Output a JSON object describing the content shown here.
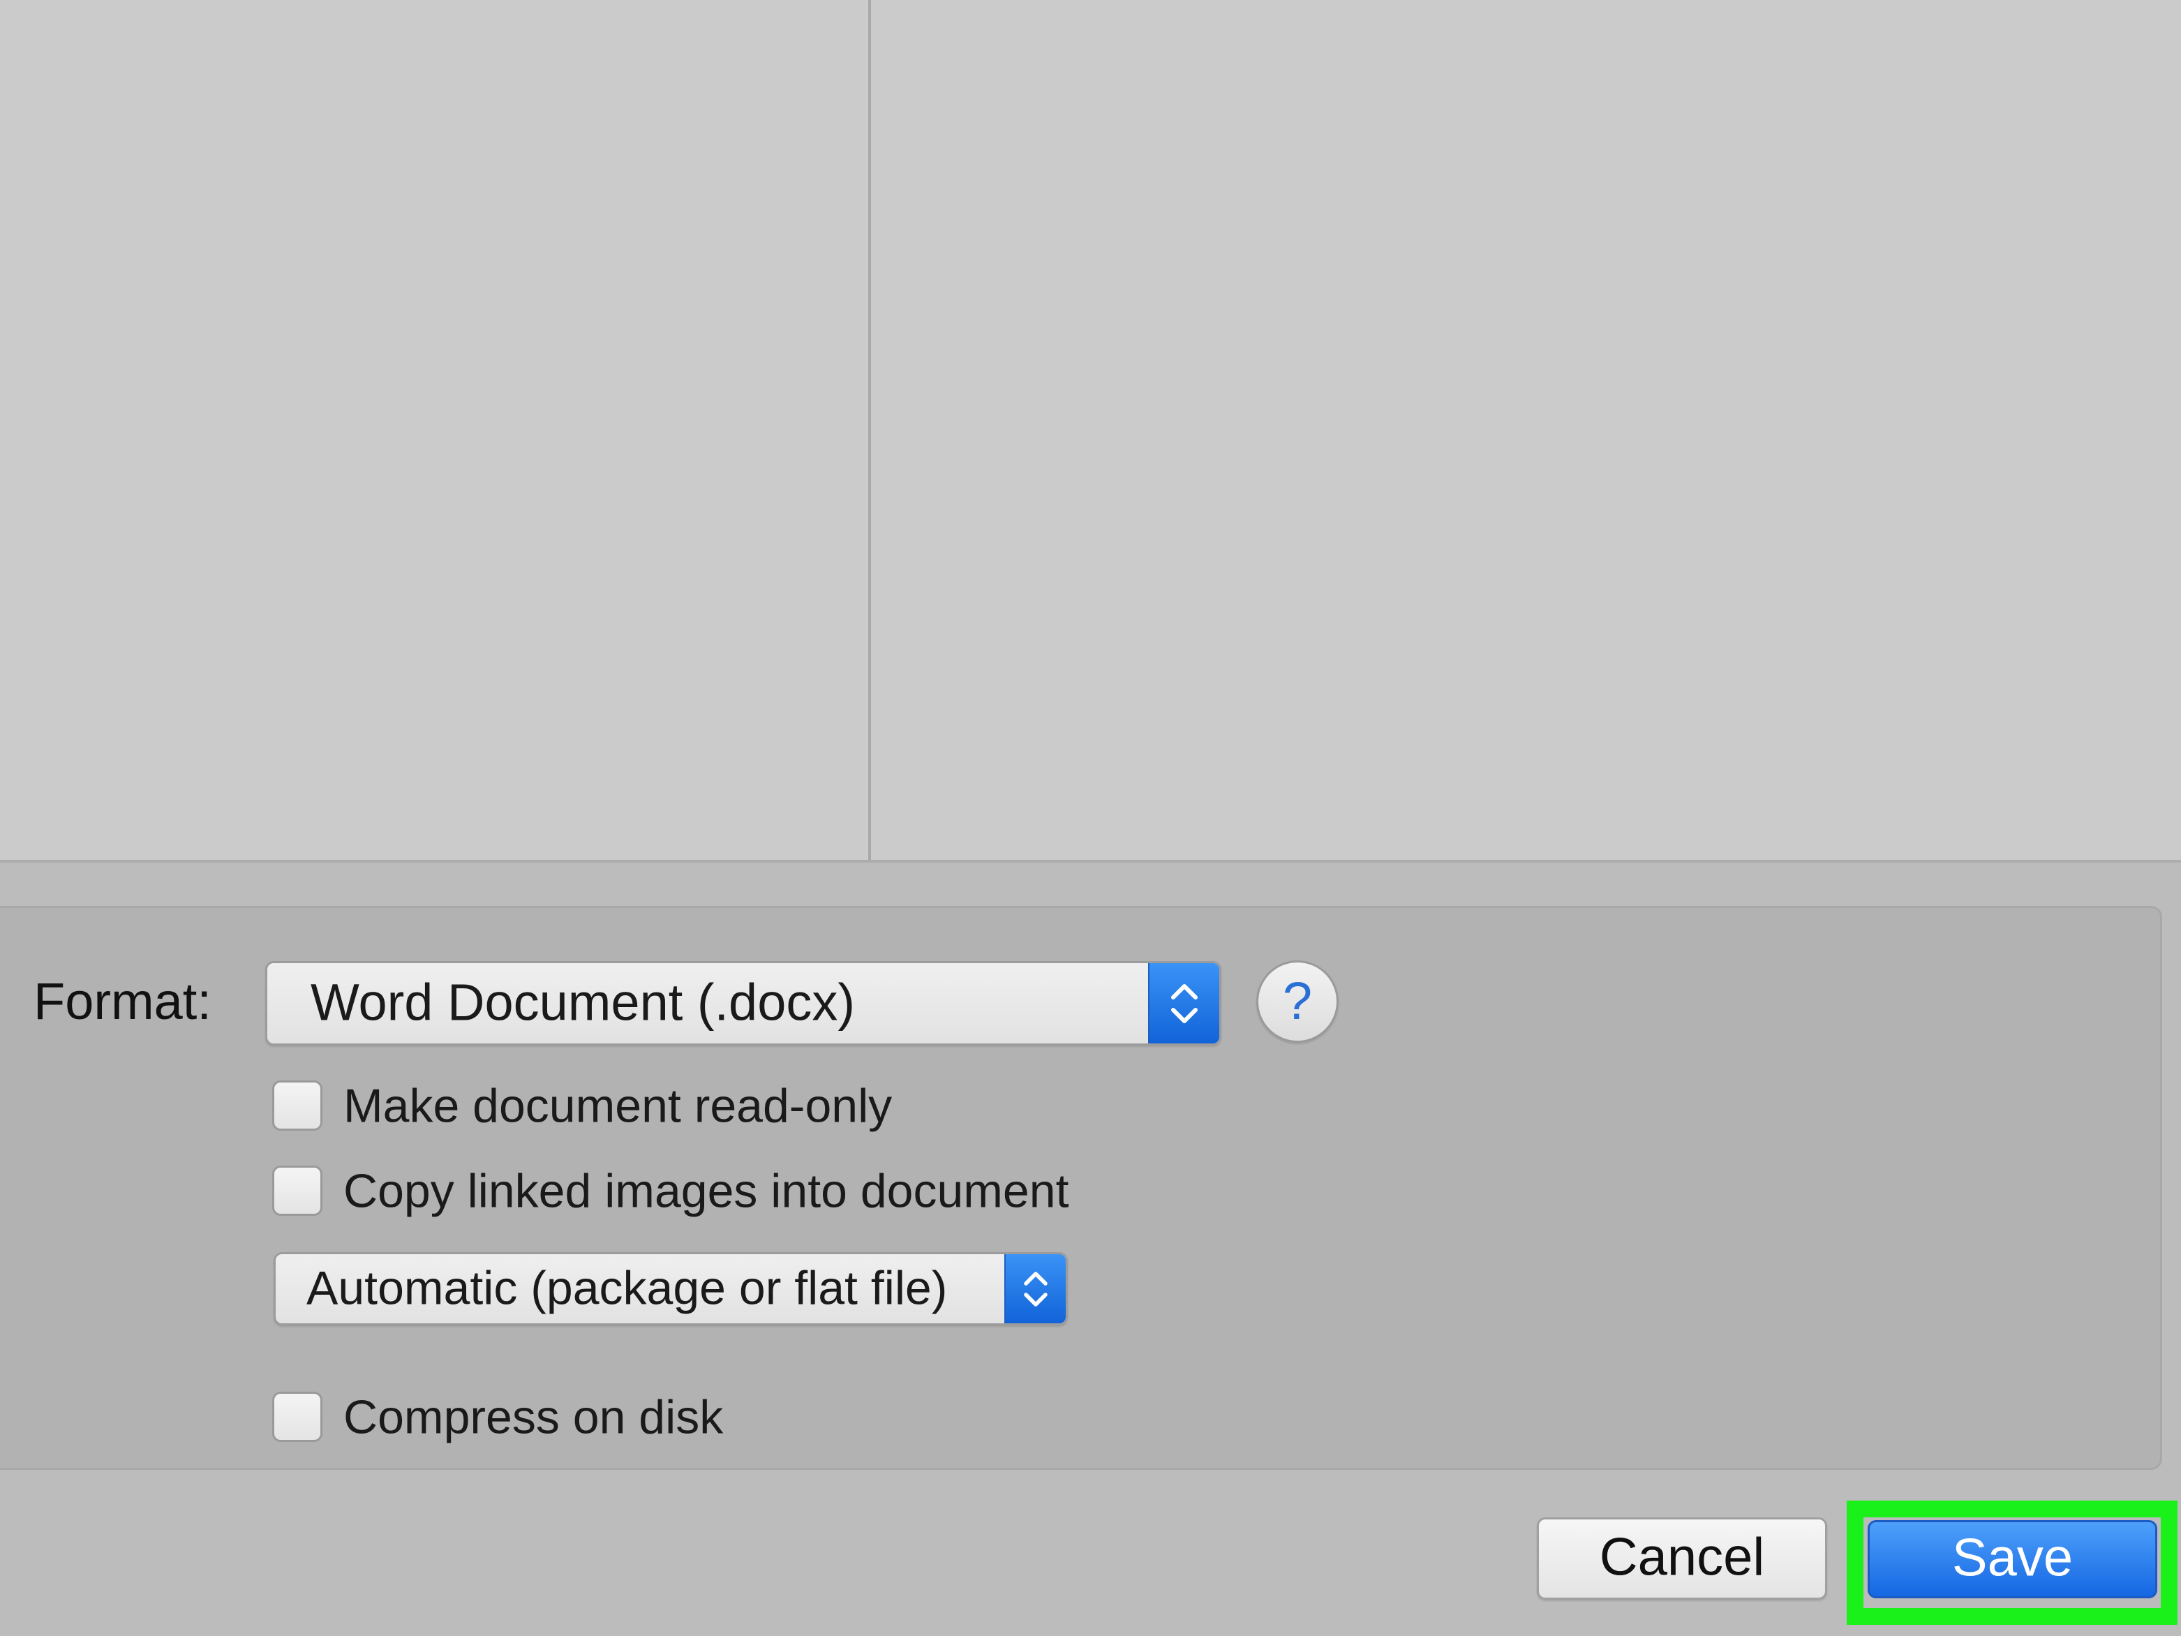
{
  "format": {
    "label": "Format:",
    "selected": "Word Document (.docx)"
  },
  "help": {
    "glyph": "?"
  },
  "options": {
    "read_only_label": "Make document read-only",
    "read_only_checked": false,
    "copy_images_label": "Copy linked images into document",
    "copy_images_checked": false,
    "package_selected": "Automatic (package or flat file)",
    "compress_label": "Compress on disk",
    "compress_checked": false
  },
  "buttons": {
    "cancel_label": "Cancel",
    "save_label": "Save"
  },
  "colors": {
    "accent": "#1b6fe6",
    "highlight": "#1af01a",
    "background": "#bcbcbc"
  },
  "icons": {
    "stepper": "up-down-chevron-icon",
    "help": "question-mark-icon"
  }
}
